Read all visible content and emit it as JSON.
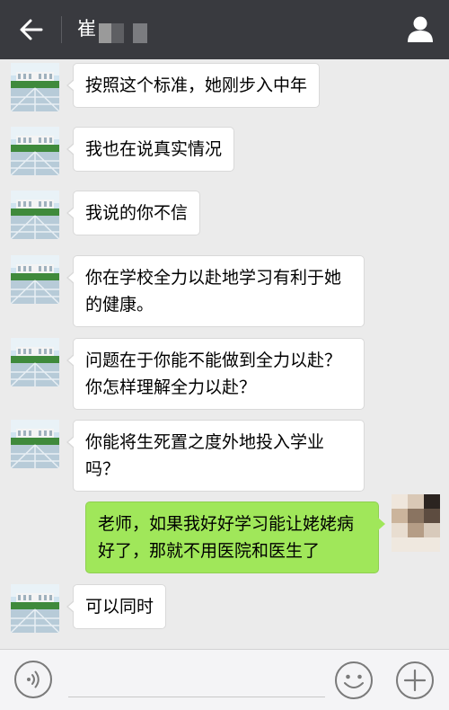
{
  "header": {
    "back_icon": "back-arrow-icon",
    "title": "崔",
    "contact_icon": "person-icon",
    "background": "#393a3f"
  },
  "messages": [
    {
      "side": "left",
      "lines": [
        "按照这个标准，她刚步入中年"
      ]
    },
    {
      "side": "left",
      "lines": [
        "我也在说真实情况"
      ]
    },
    {
      "side": "left",
      "lines": [
        "我说的你不信"
      ]
    },
    {
      "side": "left",
      "lines": [
        "你在学校全力以赴地学习有利于她",
        "的健康。"
      ]
    },
    {
      "side": "left",
      "lines": [
        "问题在于你能不能做到全力以赴？",
        "你怎样理解全力以赴？"
      ]
    },
    {
      "side": "left",
      "lines": [
        "你能将生死置之度外地投入学业",
        "吗？"
      ]
    },
    {
      "side": "right",
      "lines": [
        "老师，如果我好好学习能让姥姥病",
        "好了，那就不用医院和医生了"
      ]
    },
    {
      "side": "left",
      "lines": [
        "可以同时"
      ]
    }
  ],
  "bottom_bar": {
    "voice_icon": "voice-icon",
    "emoji_icon": "emoji-icon",
    "add_icon": "plus-icon"
  },
  "colors": {
    "incoming_bubble": "#ffffff",
    "outgoing_bubble": "#a0e75a",
    "chat_background": "#ebebeb"
  }
}
